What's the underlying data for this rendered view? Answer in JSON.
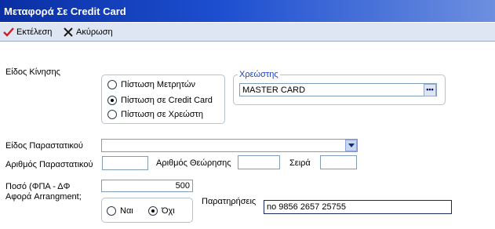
{
  "window": {
    "title": "Μεταφορά Σε Credit Card"
  },
  "toolbar": {
    "execute_label": "Εκτέλεση",
    "cancel_label": "Ακύρωση"
  },
  "form": {
    "movement_type_label": "Είδος Κίνησης",
    "movement_options": [
      "Πίστωση Μετρητών",
      "Πίστωση σε Credit Card",
      "Πίστωση σε Χρεώστη"
    ],
    "movement_selected_index": 1,
    "debtor_group_label": "Χρεώστης",
    "debtor_value": "MASTER CARD",
    "doc_type_label": "Είδος Παραστατικού",
    "doc_type_value": "",
    "doc_number_label": "Αριθμός Παραστατικού",
    "doc_number_value": "",
    "endorsement_number_label": "Αριθμός Θεώρησης",
    "endorsement_number_value": "",
    "series_label": "Σειρά",
    "series_value": "",
    "amount_label": "Ποσό (ΦΠΑ - ΔΦ",
    "amount_value": "500",
    "arrangement_label": "Αφορά Arrangment;",
    "arrangement_options": [
      "Ναι",
      "Όχι"
    ],
    "arrangement_selected_index": 1,
    "notes_label": "Παρατηρήσεις",
    "notes_value": "no 9856 2657 25755"
  },
  "colors": {
    "title_bar": "#0a2fa4",
    "group_title": "#1f3fb8",
    "execute_check": "#d41a1a"
  }
}
